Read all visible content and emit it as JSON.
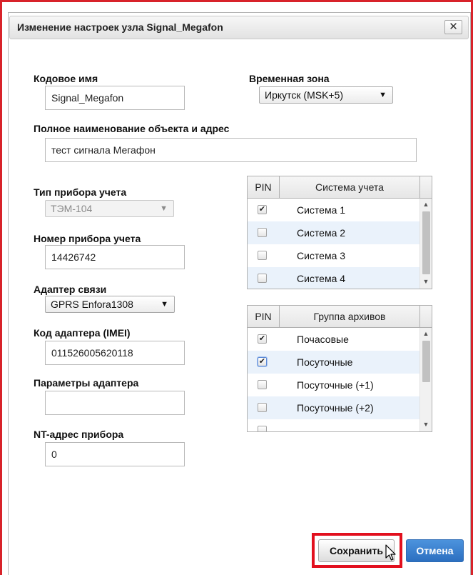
{
  "dialog": {
    "title": "Изменение настроек узла Signal_Megafon",
    "close_label": "✕"
  },
  "form": {
    "code_name_label": "Кодовое имя",
    "code_name_value": "Signal_Megafon",
    "timezone_label": "Временная зона",
    "timezone_value": "Иркутск (MSK+5)",
    "full_name_label": "Полное наименование объекта и адрес",
    "full_name_value": "тест сигнала Мегафон",
    "device_type_label": "Тип прибора учета",
    "device_type_value": "ТЭМ-104",
    "device_number_label": "Номер прибора учета",
    "device_number_value": "14426742",
    "adapter_label": "Адаптер связи",
    "adapter_value": "GPRS Enfora1308",
    "adapter_code_label": "Код адаптера (IMEI)",
    "adapter_code_value": "011526005620118",
    "adapter_params_label": "Параметры адаптера",
    "adapter_params_value": "",
    "nt_address_label": "NT-адрес прибора",
    "nt_address_value": "0"
  },
  "systems_table": {
    "col_pin": "PIN",
    "col_name": "Система учета",
    "rows": [
      {
        "name": "Система 1",
        "checked": true
      },
      {
        "name": "Система 2",
        "checked": false
      },
      {
        "name": "Система 3",
        "checked": false
      },
      {
        "name": "Система 4",
        "checked": false
      }
    ]
  },
  "archives_table": {
    "col_pin": "PIN",
    "col_name": "Группа архивов",
    "rows": [
      {
        "name": "Почасовые",
        "checked": true
      },
      {
        "name": "Посуточные",
        "checked": true
      },
      {
        "name": "Посуточные (+1)",
        "checked": false
      },
      {
        "name": "Посуточные (+2)",
        "checked": false
      }
    ]
  },
  "buttons": {
    "save": "Сохранить",
    "cancel": "Отмена"
  },
  "colors": {
    "highlight": "#e2101e",
    "cancel_button": "#2c6fc0",
    "row_alt": "#eaf2fb"
  }
}
